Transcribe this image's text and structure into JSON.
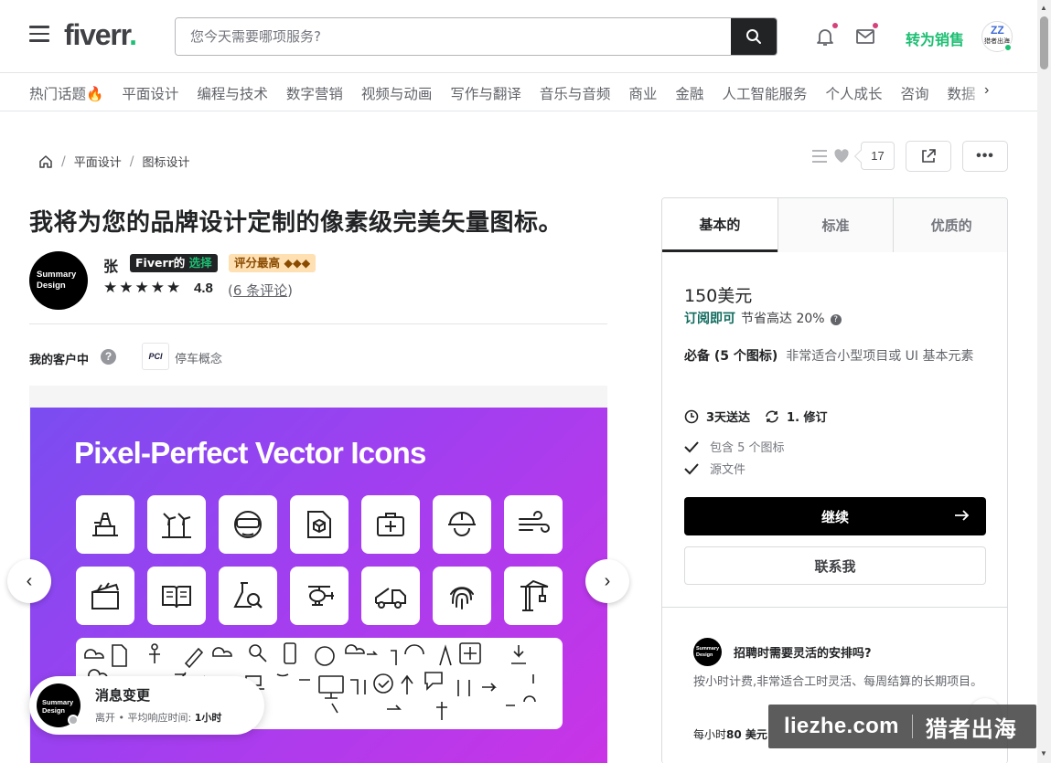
{
  "header": {
    "logo_text": "fiverr",
    "logo_dot": ".",
    "search_placeholder": "您今天需要哪项服务?",
    "become_seller": "转为销售",
    "avatar_text": "猎者出海"
  },
  "categories": [
    "热门话题🔥",
    "平面设计",
    "编程与技术",
    "数字营销",
    "视频与动画",
    "写作与翻译",
    "音乐与音频",
    "商业",
    "金融",
    "人工智能服务",
    "个人成长",
    "咨询",
    "数据"
  ],
  "breadcrumb": {
    "items": [
      "平面设计",
      "图标设计"
    ],
    "separator": "/"
  },
  "actions": {
    "like_count": "17",
    "more_label": "•••"
  },
  "gig": {
    "title": "我将为您的品牌设计定制的像素级完美矢量图标。",
    "seller_avatar_text": "Summary Design",
    "seller_name": "张",
    "badge_choice_prefix": "Fiverr的",
    "badge_choice_suffix": "选择",
    "badge_top": "评分最高 ◆◆◆",
    "stars": "★★★★★",
    "rating": "4.8",
    "reviews": "6 条评论",
    "clients_label": "我的客户中",
    "help": "?",
    "client_logo": "PCI",
    "client_name": "停车概念"
  },
  "gallery": {
    "title": "Pixel-Perfect Vector Icons",
    "prev": "‹",
    "next": "›"
  },
  "toast": {
    "avatar_text": "Summary Design",
    "title": "消息变更",
    "status": "离开",
    "bullet": "•",
    "response_label": "平均响应时间:",
    "response_value": "1小时"
  },
  "package": {
    "tabs": [
      "基本的",
      "标准",
      "优质的"
    ],
    "active_tab": 0,
    "price": "150美元",
    "subscribe_link": "订阅即可",
    "subscribe_save": "节省高达 20%",
    "title_bold": "必备 (5 个图标)",
    "title_rest": "非常适合小型项目或 UI 基本元素",
    "delivery": "3天送达",
    "revisions": "1. 修订",
    "features": [
      "包含 5 个图标",
      "源文件"
    ],
    "continue": "继续",
    "contact": "联系我",
    "hire_avatar_text": "Summary Design",
    "hire_title": "招聘时需要灵活的安排吗?",
    "hire_desc": "按小时计费,非常适合工时灵活、每周结算的长期项目。",
    "hourly_prefix": "每小时",
    "hourly_value": "80 美元"
  },
  "watermark": {
    "left": "liezhe.com",
    "right": "猎者出海"
  },
  "colors": {
    "brand_green": "#1dbf73",
    "dark": "#222325",
    "purple_start": "#7a4df0",
    "purple_end": "#c934e6"
  }
}
